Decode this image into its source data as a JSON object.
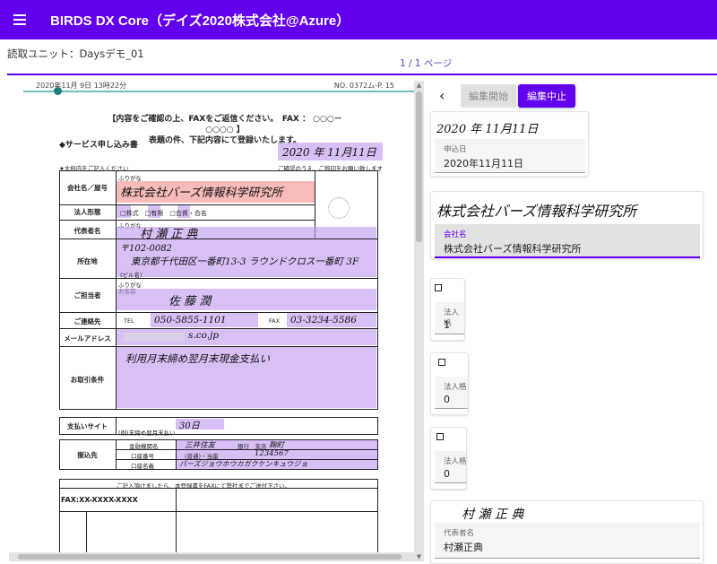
{
  "app": {
    "title": "BIRDS DX Core（デイズ2020株式会社@Azure）"
  },
  "unit": {
    "label": "読取ユニット：Daysデモ_01"
  },
  "pager": {
    "text": "1 / 1 ページ"
  },
  "toolbar": {
    "back": "‹",
    "start_label": "編集開始",
    "stop_label": "編集中止"
  },
  "document": {
    "fax_header_left": "2020年11月 9日  13時22分",
    "fax_header_right": "NO. 0372ム-P. 15",
    "notice_line1": "【内容をご確認の上、FAXをご返信ください。　FAX ： ○○○－○○○○ 】",
    "notice_line2": "表題の件、下記内容にて登録いたします。",
    "section_title": "◆サービス申し込み書",
    "note_left": "★太枠内をご記入ください",
    "note_right": "ご確認のうえ、ご捺印をお願い致します",
    "date_hw": "2020 年 11月11日",
    "furigana": "ふりがな",
    "company_label": "会社名／屋号",
    "company_hw": "株式会社バーズ情報科学研究所",
    "corp_form_label": "法人形態",
    "corp_form_options": "□株式　□有限　□合資・合名",
    "rep_label": "代表者名",
    "rep_hw": "村 瀬 正 典",
    "address_label": "所在地",
    "zip_hw": "〒102-0082",
    "address_hw": "東京都千代田区一番町13-3 ラウンドクロス一番町 3F",
    "building": "(ビル名)",
    "contact_label": "ご担当者",
    "contact_name_label": "お名前",
    "contact_hw": "佐 藤 潤",
    "phone_label": "ご連絡先",
    "tel_label": "TEL",
    "tel_hw": "050-5855-1101",
    "fax_label": "FAX",
    "fax_hw": "03-3234-5586",
    "email_label": "メールアドレス",
    "email_hw": "s.co.jp",
    "terms_label": "お取引条件",
    "terms_hw": "利用月末締め翌月末現金支払い",
    "payment_label": "支払いサイト",
    "payment_note": "(例)末締め翌月末払い",
    "payment_hw": "30日",
    "bank_label": "振込先",
    "bank_name_label": "金融機関名",
    "bank_name_hw": "三井住友",
    "branch_label": "銀行　支店",
    "branch_hw": "麹町",
    "account_no_label": "口座番号",
    "account_type_hw": "(普通)・当座",
    "account_no_hw": "1234567",
    "account_holder_label": "口座名義",
    "account_holder_hw": "バーズジョウホウカガクケンキュウジョ",
    "footer_note": "ご記入頂けましたら、本登録書をFAXにて弊社までご送付下さい。",
    "footer_fax": "FAX:XX-XXXX-XXXX"
  },
  "fields": [
    {
      "snippet": "2020 年 11月11日",
      "label": "申込日",
      "value": "2020年11月11日"
    },
    {
      "snippet": "株式会社バーズ情報科学研究所",
      "label": "会社名",
      "value": "株式会社バーズ情報科学研究所"
    },
    {
      "label": "法人格",
      "value": "1"
    },
    {
      "label": "法人格",
      "value": "0"
    },
    {
      "label": "法人格",
      "value": "0"
    },
    {
      "snippet": "村 瀬 正 典",
      "label": "代表者名",
      "value": "村瀬正典"
    }
  ],
  "colors": {
    "primary": "#6200ee",
    "highlight": "#c8a8f5",
    "highlight_red": "#f49696"
  }
}
